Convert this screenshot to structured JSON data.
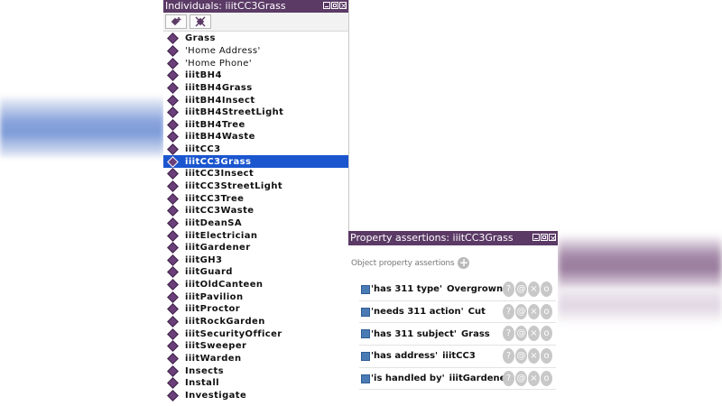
{
  "individuals_panel": {
    "title": "Individuals: iiitCC3Grass",
    "toolbar": {
      "add_icon": "add-individual-icon",
      "delete_icon": "delete-individual-icon"
    },
    "items": [
      {
        "label": "Grass",
        "style": "bold"
      },
      {
        "label": "'Home Address'",
        "style": "plain"
      },
      {
        "label": "'Home Phone'",
        "style": "plain"
      },
      {
        "label": "iiitBH4",
        "style": "bold"
      },
      {
        "label": "iiitBH4Grass",
        "style": "bold"
      },
      {
        "label": "iiitBH4Insect",
        "style": "bold"
      },
      {
        "label": "iiitBH4StreetLight",
        "style": "bold"
      },
      {
        "label": "iiitBH4Tree",
        "style": "bold"
      },
      {
        "label": "iiitBH4Waste",
        "style": "bold"
      },
      {
        "label": "iiitCC3",
        "style": "bold"
      },
      {
        "label": "iiitCC3Grass",
        "style": "bold",
        "selected": true
      },
      {
        "label": "iiitCC3Insect",
        "style": "bold"
      },
      {
        "label": "iiitCC3StreetLight",
        "style": "bold"
      },
      {
        "label": "iiitCC3Tree",
        "style": "bold"
      },
      {
        "label": "iiitCC3Waste",
        "style": "bold"
      },
      {
        "label": "iiitDeanSA",
        "style": "bold"
      },
      {
        "label": "iiitElectrician",
        "style": "bold"
      },
      {
        "label": "iiitGardener",
        "style": "bold"
      },
      {
        "label": "iiitGH3",
        "style": "bold"
      },
      {
        "label": "iiitGuard",
        "style": "bold"
      },
      {
        "label": "iiitOldCanteen",
        "style": "bold"
      },
      {
        "label": "iiitPavilion",
        "style": "bold"
      },
      {
        "label": "iiitProctor",
        "style": "bold"
      },
      {
        "label": "iiitRockGarden",
        "style": "bold"
      },
      {
        "label": "iiitSecurityOfficer",
        "style": "bold"
      },
      {
        "label": "iiitSweeper",
        "style": "bold"
      },
      {
        "label": "iiitWarden",
        "style": "bold"
      },
      {
        "label": "Insects",
        "style": "bold"
      },
      {
        "label": "Install",
        "style": "bold"
      },
      {
        "label": "Investigate",
        "style": "bold"
      }
    ]
  },
  "property_panel": {
    "title": "Property assertions: iiitCC3Grass",
    "section_label": "Object property assertions",
    "assertions": [
      {
        "property": "'has 311 type'",
        "value": "Overgrown"
      },
      {
        "property": "'needs 311 action'",
        "value": "Cut"
      },
      {
        "property": "'has 311 subject'",
        "value": "Grass"
      },
      {
        "property": "'has address'",
        "value": "iiitCC3"
      },
      {
        "property": "'is handled by'",
        "value": "iiitGardener"
      }
    ],
    "row_buttons": [
      "?",
      "@",
      "×",
      "o"
    ]
  },
  "colors": {
    "titlebar": "#5b3a66",
    "selection": "#1b56cf",
    "individual_icon": "#6b3f7a",
    "property_icon": "#4a7bb5"
  }
}
